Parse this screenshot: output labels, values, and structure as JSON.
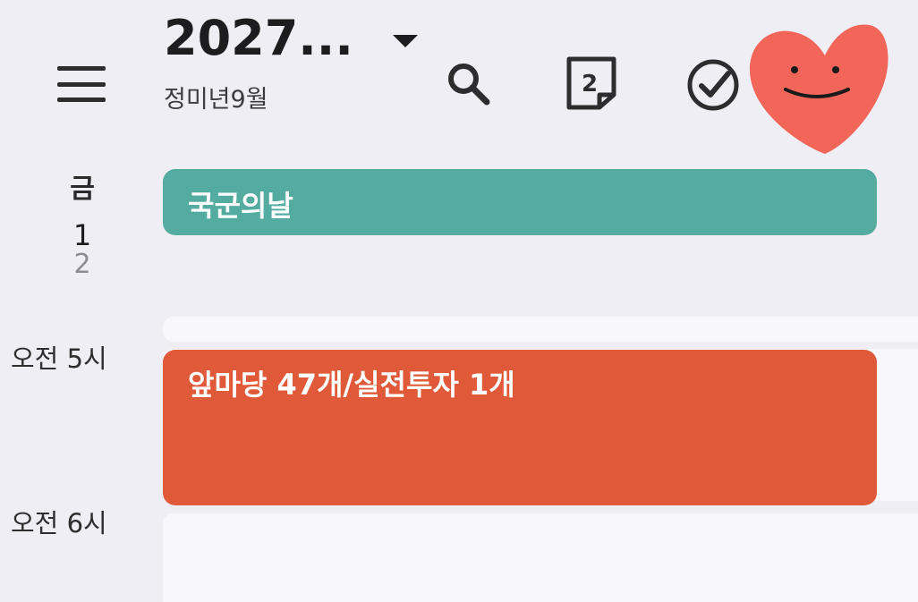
{
  "header": {
    "title": "2027...",
    "subtitle": "정미년9월",
    "today_badge": "2"
  },
  "day": {
    "weekday": "금",
    "date": "1",
    "alt_date": "2"
  },
  "times": {
    "five": "오전 5시",
    "six": "오전 6시"
  },
  "events": {
    "allday_title": "국군의날",
    "timed_title": "앞마당 47개/실전투자 1개"
  },
  "colors": {
    "allday_event": "#54aba0",
    "timed_event": "#e05a3a",
    "avatar": "#f2665a"
  },
  "icons": {
    "menu": "hamburger-menu-icon",
    "search": "search-icon",
    "today": "calendar-today-icon",
    "tasks": "check-circle-icon",
    "avatar": "heart-face-avatar"
  }
}
